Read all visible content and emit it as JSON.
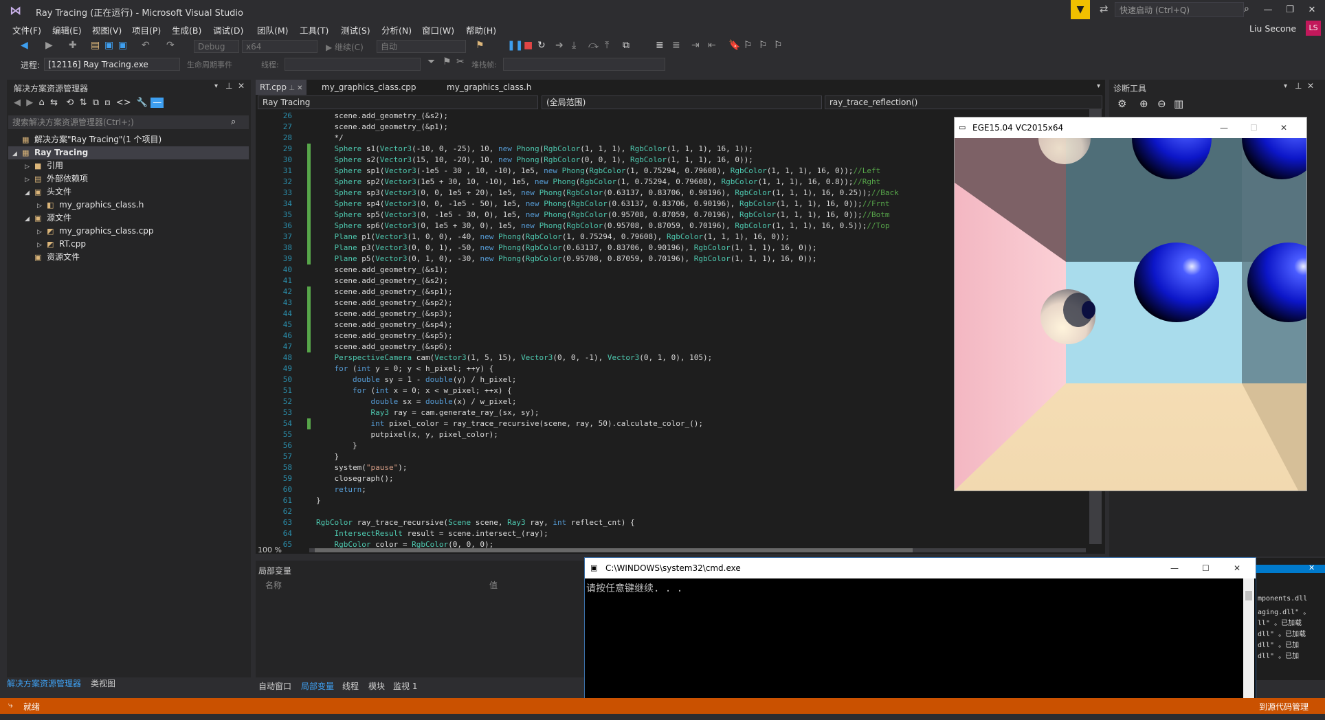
{
  "window": {
    "title": "Ray Tracing (正在运行) - Microsoft Visual Studio",
    "quick_launch_placeholder": "快速启动 (Ctrl+Q)",
    "user_name": "Liu Secone",
    "user_initials": "LS"
  },
  "menu": [
    "文件(F)",
    "编辑(E)",
    "视图(V)",
    "项目(P)",
    "生成(B)",
    "调试(D)",
    "团队(M)",
    "工具(T)",
    "测试(S)",
    "分析(N)",
    "窗口(W)",
    "帮助(H)"
  ],
  "toolbar": {
    "config": "Debug",
    "platform": "x64",
    "continue": "继续(C)",
    "auto": "自动",
    "process_label": "进程:",
    "process_value": "[12116] Ray Tracing.exe",
    "lifecycle": "生命周期事件",
    "thread_label": "线程:",
    "stack_label": "堆栈帧:"
  },
  "solution_explorer": {
    "title": "解决方案资源管理器",
    "search_placeholder": "搜索解决方案资源管理器(Ctrl+;)",
    "items": [
      {
        "label": "解决方案\"Ray Tracing\"(1 个项目)",
        "depth": 0,
        "expander": "",
        "selected": false
      },
      {
        "label": "Ray Tracing",
        "depth": 0,
        "expander": "◢",
        "selected": true
      },
      {
        "label": "引用",
        "depth": 1,
        "expander": "▷",
        "selected": false
      },
      {
        "label": "外部依赖项",
        "depth": 1,
        "expander": "▷",
        "selected": false
      },
      {
        "label": "头文件",
        "depth": 1,
        "expander": "◢",
        "selected": false
      },
      {
        "label": "my_graphics_class.h",
        "depth": 2,
        "expander": "▷",
        "selected": false
      },
      {
        "label": "源文件",
        "depth": 1,
        "expander": "◢",
        "selected": false
      },
      {
        "label": "my_graphics_class.cpp",
        "depth": 2,
        "expander": "▷",
        "selected": false
      },
      {
        "label": "RT.cpp",
        "depth": 2,
        "expander": "▷",
        "selected": false
      },
      {
        "label": "资源文件",
        "depth": 1,
        "expander": "",
        "selected": false
      }
    ],
    "bottom_tabs": [
      "解决方案资源管理器",
      "类视图"
    ]
  },
  "editor": {
    "tabs": [
      "RT.cpp",
      "my_graphics_class.cpp",
      "my_graphics_class.h"
    ],
    "nav_project": "Ray Tracing",
    "nav_scope": "(全局范围)",
    "nav_function": "ray_trace_reflection()",
    "zoom": "100 %",
    "first_line": 26,
    "lines": [
      "    scene.add_geometry_(&s2);",
      "    scene.add_geometry_(&p1);",
      "    */",
      "    Sphere s1(Vector3(-10, 0, -25), 10, new Phong(RgbColor(1, 1, 1), RgbColor(1, 1, 1), 16, 1));",
      "    Sphere s2(Vector3(15, 10, -20), 10, new Phong(RgbColor(0, 0, 1), RgbColor(1, 1, 1), 16, 0));",
      "    Sphere sp1(Vector3(-1e5 - 30 , 10, -10), 1e5, new Phong(RgbColor(1, 0.75294, 0.79608), RgbColor(1, 1, 1), 16, 0));//Left",
      "    Sphere sp2(Vector3(1e5 + 30, 10, -10), 1e5, new Phong(RgbColor(1, 0.75294, 0.79608), RgbColor(1, 1, 1), 16, 0.8));//Rght",
      "    Sphere sp3(Vector3(0, 0, 1e5 + 20), 1e5, new Phong(RgbColor(0.63137, 0.83706, 0.90196), RgbColor(1, 1, 1), 16, 0.25));//Back",
      "    Sphere sp4(Vector3(0, 0, -1e5 - 50), 1e5, new Phong(RgbColor(0.63137, 0.83706, 0.90196), RgbColor(1, 1, 1), 16, 0));//Frnt",
      "    Sphere sp5(Vector3(0, -1e5 - 30, 0), 1e5, new Phong(RgbColor(0.95708, 0.87059, 0.70196), RgbColor(1, 1, 1), 16, 0));//Botm",
      "    Sphere sp6(Vector3(0, 1e5 + 30, 0), 1e5, new Phong(RgbColor(0.95708, 0.87059, 0.70196), RgbColor(1, 1, 1), 16, 0.5));//Top",
      "    Plane p1(Vector3(1, 0, 0), -40, new Phong(RgbColor(1, 0.75294, 0.79608), RgbColor(1, 1, 1), 16, 0));",
      "    Plane p3(Vector3(0, 0, 1), -50, new Phong(RgbColor(0.63137, 0.83706, 0.90196), RgbColor(1, 1, 1), 16, 0));",
      "    Plane p5(Vector3(0, 1, 0), -30, new Phong(RgbColor(0.95708, 0.87059, 0.70196), RgbColor(1, 1, 1), 16, 0));",
      "    scene.add_geometry_(&s1);",
      "    scene.add_geometry_(&s2);",
      "    scene.add_geometry_(&sp1);",
      "    scene.add_geometry_(&sp2);",
      "    scene.add_geometry_(&sp3);",
      "    scene.add_geometry_(&sp4);",
      "    scene.add_geometry_(&sp5);",
      "    scene.add_geometry_(&sp6);",
      "    PerspectiveCamera cam(Vector3(1, 5, 15), Vector3(0, 0, -1), Vector3(0, 1, 0), 105);",
      "    for (int y = 0; y < h_pixel; ++y) {",
      "        double sy = 1 - double(y) / h_pixel;",
      "        for (int x = 0; x < w_pixel; ++x) {",
      "            double sx = double(x) / w_pixel;",
      "            Ray3 ray = cam.generate_ray_(sx, sy);",
      "            int pixel_color = ray_trace_recursive(scene, ray, 50).calculate_color_();",
      "            putpixel(x, y, pixel_color);",
      "        }",
      "    }",
      "    system(\"pause\");",
      "    closegraph();",
      "    return;",
      "}",
      "",
      "RgbColor ray_trace_recursive(Scene scene, Ray3 ray, int reflect_cnt) {",
      "    IntersectResult result = scene.intersect_(ray);",
      "    RgbColor color = RgbColor(0, 0, 0);"
    ]
  },
  "locals": {
    "title": "局部变量",
    "col_name": "名称",
    "col_value": "值",
    "bottom_tabs": [
      "自动窗口",
      "局部变量",
      "线程",
      "模块",
      "监视 1"
    ]
  },
  "diagnostics": {
    "title": "诊断工具"
  },
  "ege_window": {
    "title": "EGE15.04 VC2015x64"
  },
  "cmd_window": {
    "title": "C:\\WINDOWS\\system32\\cmd.exe",
    "text": "请按任意键继续. . ."
  },
  "output_fragments": [
    "mponents.dll",
    "aging.dll\" 。",
    "ll\" 。已加载",
    "dll\" 。已加载",
    "dll\" 。已加",
    "dll\" 。已加"
  ],
  "status": {
    "text": "就绪",
    "right": "到源代码管理"
  },
  "colors": {
    "status_bar": "#ca5100",
    "accent": "#3e9ff0",
    "line_number": "#2b91af"
  }
}
